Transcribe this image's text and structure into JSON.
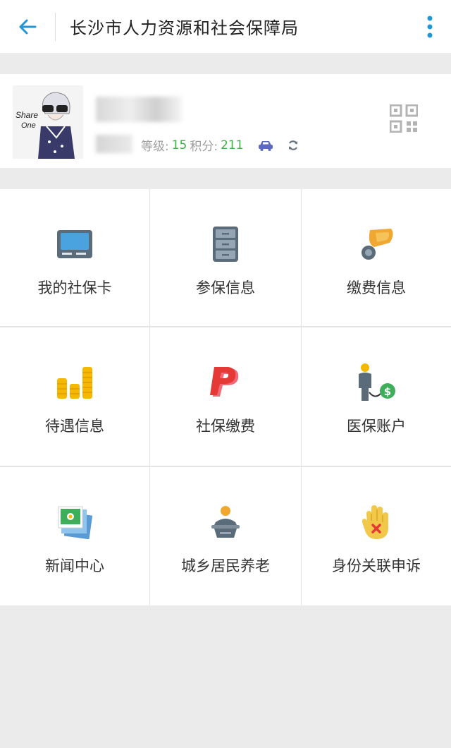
{
  "header": {
    "title": "长沙市人力资源和社会保障局",
    "back_icon": "arrow-left-icon",
    "menu_icon": "more-vertical-icon",
    "accent": "#2196d6"
  },
  "profile": {
    "avatar_text": "Share One",
    "level_label": "等级:",
    "level_value": "15",
    "points_label": "积分:",
    "points_value": "211",
    "level_color": "#3cb043"
  },
  "menu": [
    {
      "label": "我的社保卡",
      "icon": "social-card-icon"
    },
    {
      "label": "参保信息",
      "icon": "cabinet-icon"
    },
    {
      "label": "缴费信息",
      "icon": "payment-hand-icon"
    },
    {
      "label": "待遇信息",
      "icon": "coin-stacks-icon"
    },
    {
      "label": "社保缴费",
      "icon": "p-logo-icon"
    },
    {
      "label": "医保账户",
      "icon": "person-dollar-icon"
    },
    {
      "label": "新闻中心",
      "icon": "news-photos-icon"
    },
    {
      "label": "城乡居民养老",
      "icon": "resident-icon"
    },
    {
      "label": "身份关联申诉",
      "icon": "hand-stop-icon"
    }
  ]
}
